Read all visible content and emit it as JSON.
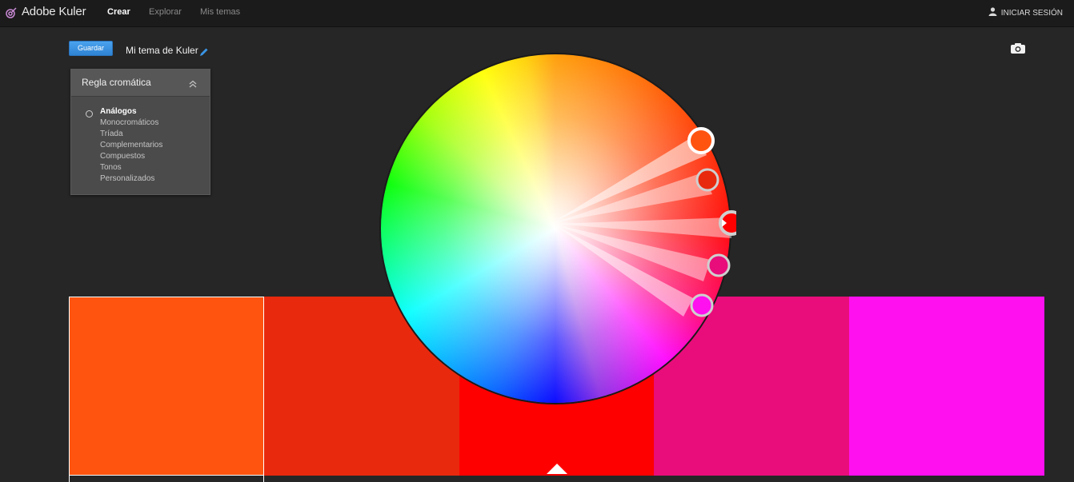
{
  "app": {
    "title": "Adobe Kuler",
    "nav": [
      "Crear",
      "Explorar",
      "Mis temas"
    ],
    "active_nav": "Crear",
    "signin_label": "INICIAR SESIÓN"
  },
  "toolbar": {
    "save_label": "Guardar",
    "theme_name": "Mi tema de Kuler"
  },
  "rules_panel": {
    "title": "Regla cromática",
    "items": [
      "Análogos",
      "Monocromáticos",
      "Tríada",
      "Complementarios",
      "Compuestos",
      "Tonos",
      "Personalizados"
    ],
    "selected": "Análogos"
  },
  "swatches": [
    {
      "color": "#ff5410",
      "selected": true
    },
    {
      "color": "#e8290d",
      "selected": false
    },
    {
      "color": "#ff0000",
      "selected": false
    },
    {
      "color": "#e80d7a",
      "selected": false
    },
    {
      "color": "#ff10ef",
      "selected": false
    }
  ],
  "base_swatch_index": 2,
  "icons": {
    "logo": "kuler-logo-icon",
    "user": "user-icon",
    "pencil": "pencil-icon",
    "camera": "camera-icon",
    "collapse": "chevron-up-double-icon",
    "radio": "radio-icon"
  }
}
